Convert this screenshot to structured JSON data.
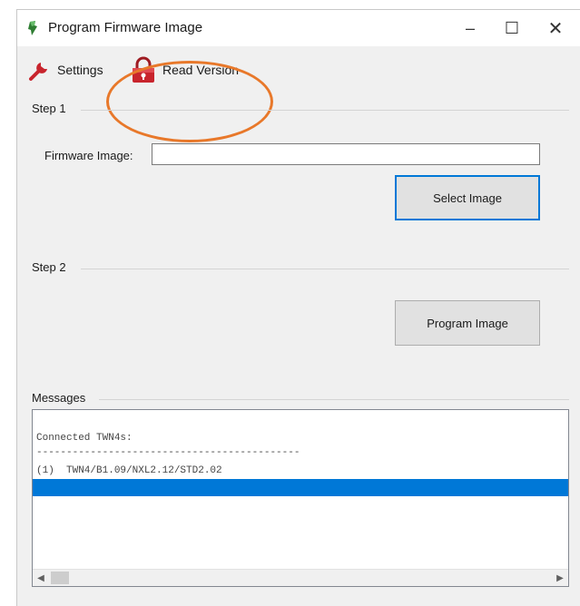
{
  "window": {
    "title": "Program Firmware Image",
    "controls": {
      "minimize": "–",
      "maximize": "☐",
      "close": "✕"
    }
  },
  "toolbar": {
    "settings_label": "Settings",
    "read_version_label": "Read Version",
    "settings_icon": "wrench-icon",
    "read_version_icon": "padlock-icon"
  },
  "step1": {
    "title": "Step 1",
    "firmware_label": "Firmware Image:",
    "firmware_value": "",
    "select_button": "Select Image"
  },
  "step2": {
    "title": "Step 2",
    "program_button": "Program Image"
  },
  "messages": {
    "title": "Messages",
    "lines": [
      "Connected TWN4s:",
      "--------------------------------------------",
      "(1)  TWN4/B1.09/NXL2.12/STD2.02",
      ""
    ],
    "selected_index": 3
  },
  "colors": {
    "highlight": "#e8782a",
    "selection": "#0078d7",
    "accent_icon": "#c8242d"
  }
}
